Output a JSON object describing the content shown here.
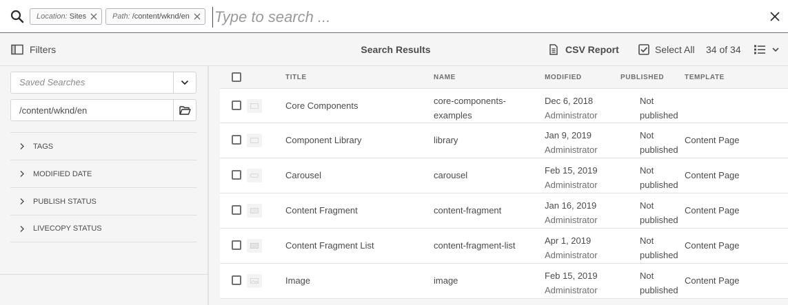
{
  "search": {
    "tags": [
      {
        "key": "Location:",
        "value": "Sites"
      },
      {
        "key": "Path:",
        "value": "/content/wknd/en"
      }
    ],
    "placeholder": "Type to search ..."
  },
  "actionbar": {
    "filters_label": "Filters",
    "results_title": "Search Results",
    "csv_label": "CSV Report",
    "select_all_label": "Select All",
    "count": "34 of 34"
  },
  "sidebar": {
    "saved_searches_placeholder": "Saved Searches",
    "path_value": "/content/wknd/en",
    "facets": [
      "TAGS",
      "MODIFIED DATE",
      "PUBLISH STATUS",
      "LIVECOPY STATUS"
    ]
  },
  "table": {
    "columns": {
      "title": "TITLE",
      "name": "NAME",
      "modified": "MODIFIED",
      "published": "PUBLISHED",
      "template": "TEMPLATE"
    },
    "rows": [
      {
        "title": "Core Components",
        "name_line1": "core-components-",
        "name_line2": "examples",
        "modified_date": "Dec 6, 2018",
        "modified_by": "Administrator",
        "pub_line1": "Not",
        "pub_line2": "published",
        "template": ""
      },
      {
        "title": "Component Library",
        "name_line1": "library",
        "name_line2": "",
        "modified_date": "Jan 9, 2019",
        "modified_by": "Administrator",
        "pub_line1": "Not",
        "pub_line2": "published",
        "template": "Content Page"
      },
      {
        "title": "Carousel",
        "name_line1": "carousel",
        "name_line2": "",
        "modified_date": "Feb 15, 2019",
        "modified_by": "Administrator",
        "pub_line1": "Not",
        "pub_line2": "published",
        "template": "Content Page"
      },
      {
        "title": "Content Fragment",
        "name_line1": "content-fragment",
        "name_line2": "",
        "modified_date": "Jan 16, 2019",
        "modified_by": "Administrator",
        "pub_line1": "Not",
        "pub_line2": "published",
        "template": "Content Page"
      },
      {
        "title": "Content Fragment List",
        "name_line1": "content-fragment-list",
        "name_line2": "",
        "modified_date": "Apr 1, 2019",
        "modified_by": "Administrator",
        "pub_line1": "Not",
        "pub_line2": "published",
        "template": "Content Page"
      },
      {
        "title": "Image",
        "name_line1": "image",
        "name_line2": "",
        "modified_date": "Feb 15, 2019",
        "modified_by": "Administrator",
        "pub_line1": "Not",
        "pub_line2": "published",
        "template": "Content Page"
      }
    ]
  }
}
